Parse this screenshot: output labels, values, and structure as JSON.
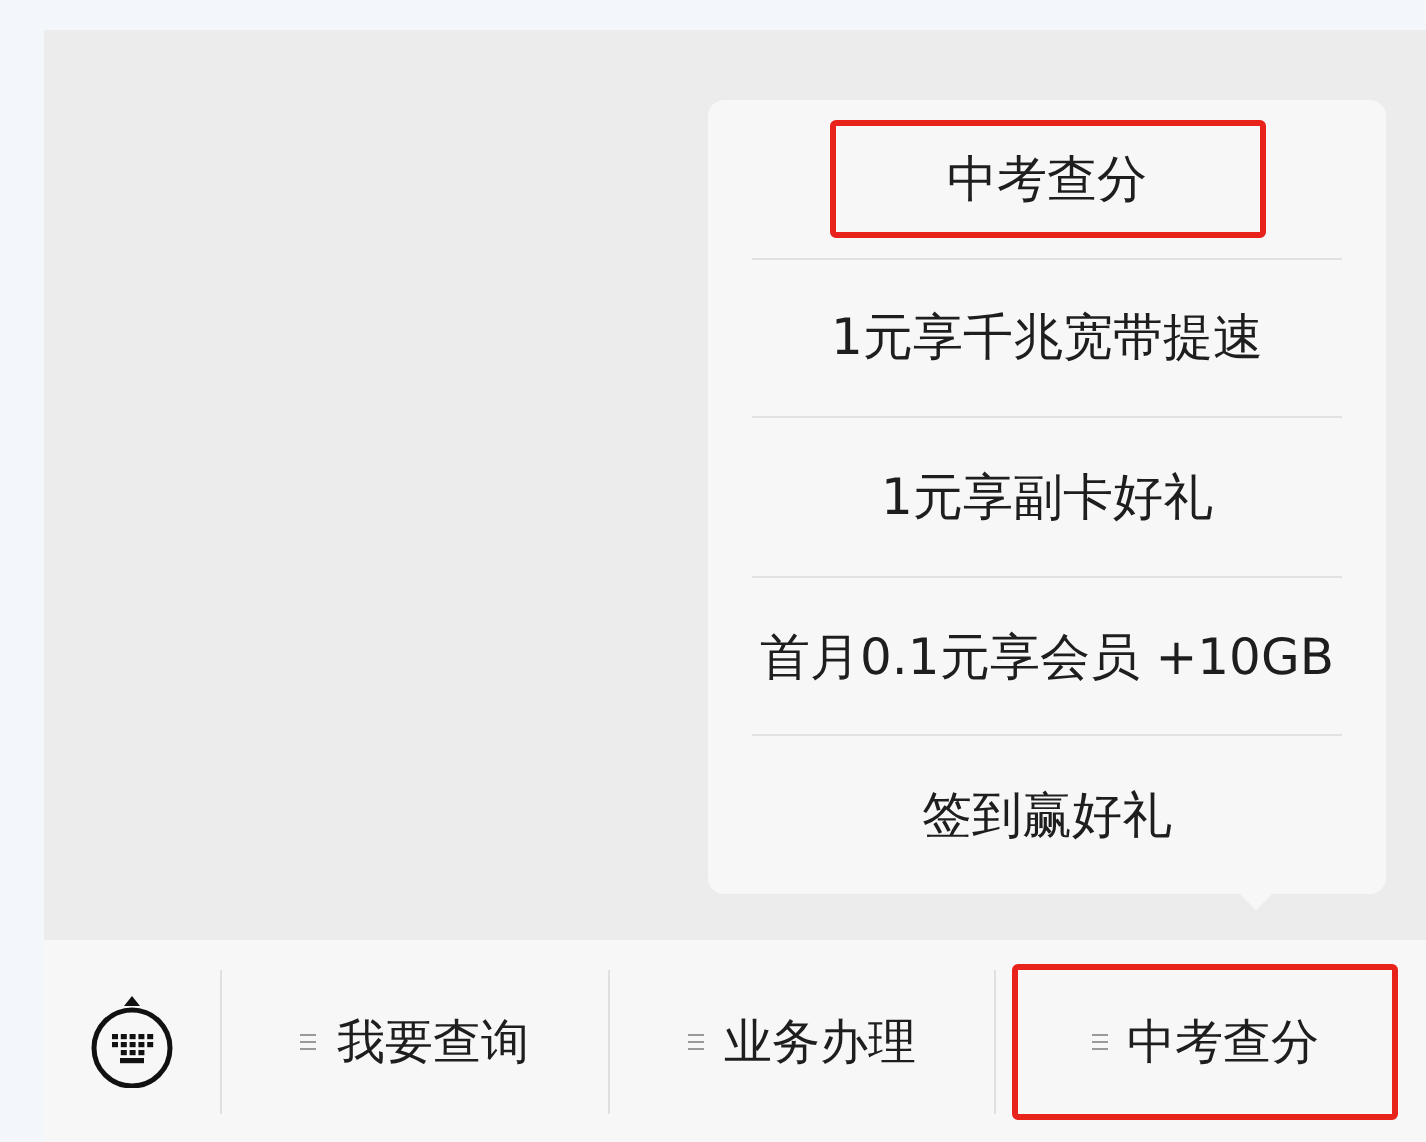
{
  "submenu": [
    {
      "label": "中考查分",
      "highlighted": true
    },
    {
      "label": "1元享千兆宽带提速",
      "highlighted": false
    },
    {
      "label": "1元享副卡好礼",
      "highlighted": false
    },
    {
      "label": "首月0.1元享会员 +10GB",
      "highlighted": false
    },
    {
      "label": "签到赢好礼",
      "highlighted": false
    }
  ],
  "menu_bar": [
    {
      "label": "我要查询",
      "highlighted": false
    },
    {
      "label": "业务办理",
      "highlighted": false
    },
    {
      "label": "中考查分",
      "highlighted": true
    }
  ]
}
